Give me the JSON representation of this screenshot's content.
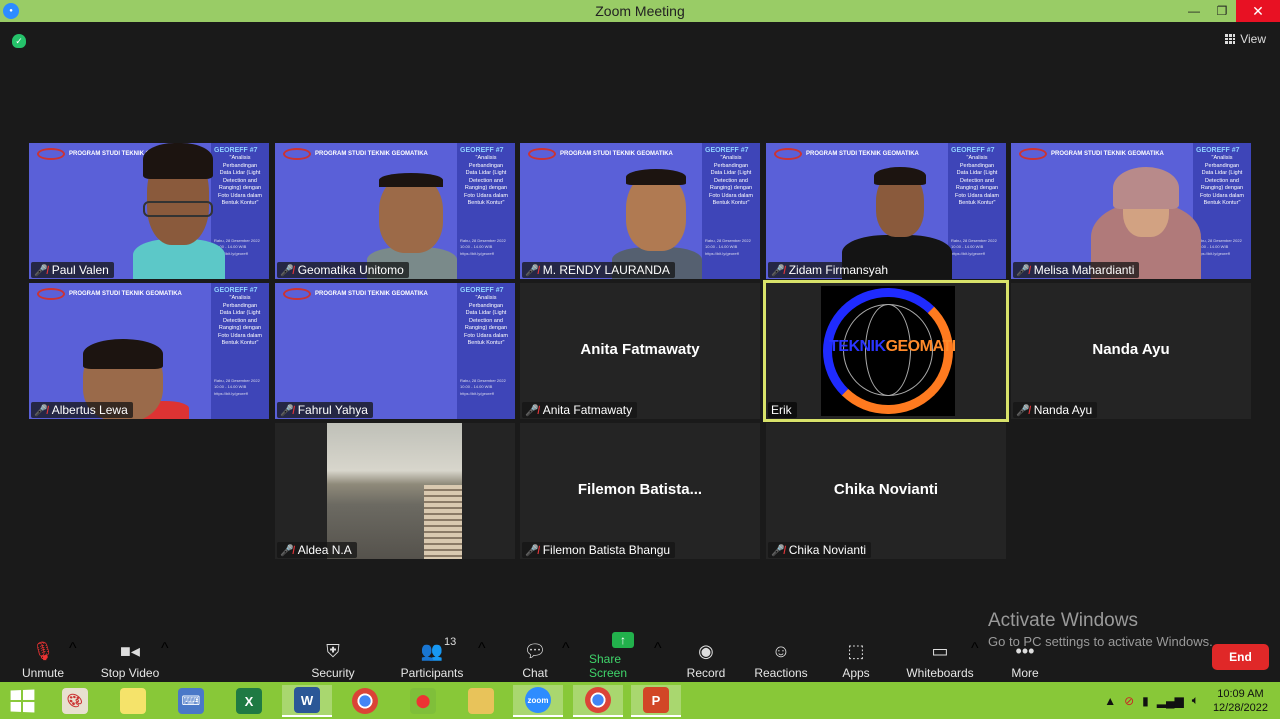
{
  "window": {
    "title": "Zoom Meeting"
  },
  "view_button": {
    "label": "View"
  },
  "slide": {
    "header": "PROGRAM STUDI TEKNIK GEOMATIKA",
    "tag": "GEOREFF #7",
    "title_lines": [
      "\"Analisis",
      "Perbandingan",
      "Data Lidar (Light",
      "Detection and",
      "Ranging) dengan",
      "Foto Udara dalam",
      "Bentuk Kontur\""
    ],
    "meta_lines": [
      "Rabu, 28 Desember 2022",
      "10.00 - 14.00 WIB",
      "https://bit.ly/georeff"
    ]
  },
  "participants": [
    {
      "name": "Paul Valen",
      "type": "video"
    },
    {
      "name": "Geomatika Unitomo",
      "type": "video"
    },
    {
      "name": "M. RENDY LAURANDA",
      "type": "video"
    },
    {
      "name": "Zidam Firmansyah",
      "type": "video"
    },
    {
      "name": "Melisa Mahardianti",
      "type": "video"
    },
    {
      "name": "Albertus Lewa",
      "type": "video"
    },
    {
      "name": "Fahrul Yahya",
      "type": "video"
    },
    {
      "name": "Anita Fatmawaty",
      "display": "Anita Fatmawaty",
      "type": "name"
    },
    {
      "name": "Erik",
      "type": "logo",
      "logo_a": "TEKNIK",
      "logo_b": "GEOMATIKA"
    },
    {
      "name": "Nanda Ayu",
      "display": "Nanda Ayu",
      "type": "name"
    },
    {
      "name": "Aldea N.A",
      "type": "photo"
    },
    {
      "name": "Filemon Batista Bhangu",
      "display": "Filemon  Batista...",
      "type": "name"
    },
    {
      "name": "Chika Novianti",
      "display": "Chika Novianti",
      "type": "name"
    }
  ],
  "watermark": {
    "line1": "Activate Windows",
    "line2": "Go to PC settings to activate Windows."
  },
  "toolbar": {
    "unmute": "Unmute",
    "stop_video": "Stop Video",
    "security": "Security",
    "participants": "Participants",
    "participants_count": "13",
    "chat": "Chat",
    "share_screen": "Share Screen",
    "record": "Record",
    "reactions": "Reactions",
    "apps": "Apps",
    "whiteboards": "Whiteboards",
    "more": "More",
    "end": "End"
  },
  "taskbar": {
    "time": "10:09 AM",
    "date": "12/28/2022",
    "zoom_label": "zoom"
  },
  "colors": {
    "title_bar": "#99cc66",
    "taskbar": "#88c838",
    "end": "#e02828",
    "share": "#22b14c",
    "active_border": "#d8e26a"
  }
}
